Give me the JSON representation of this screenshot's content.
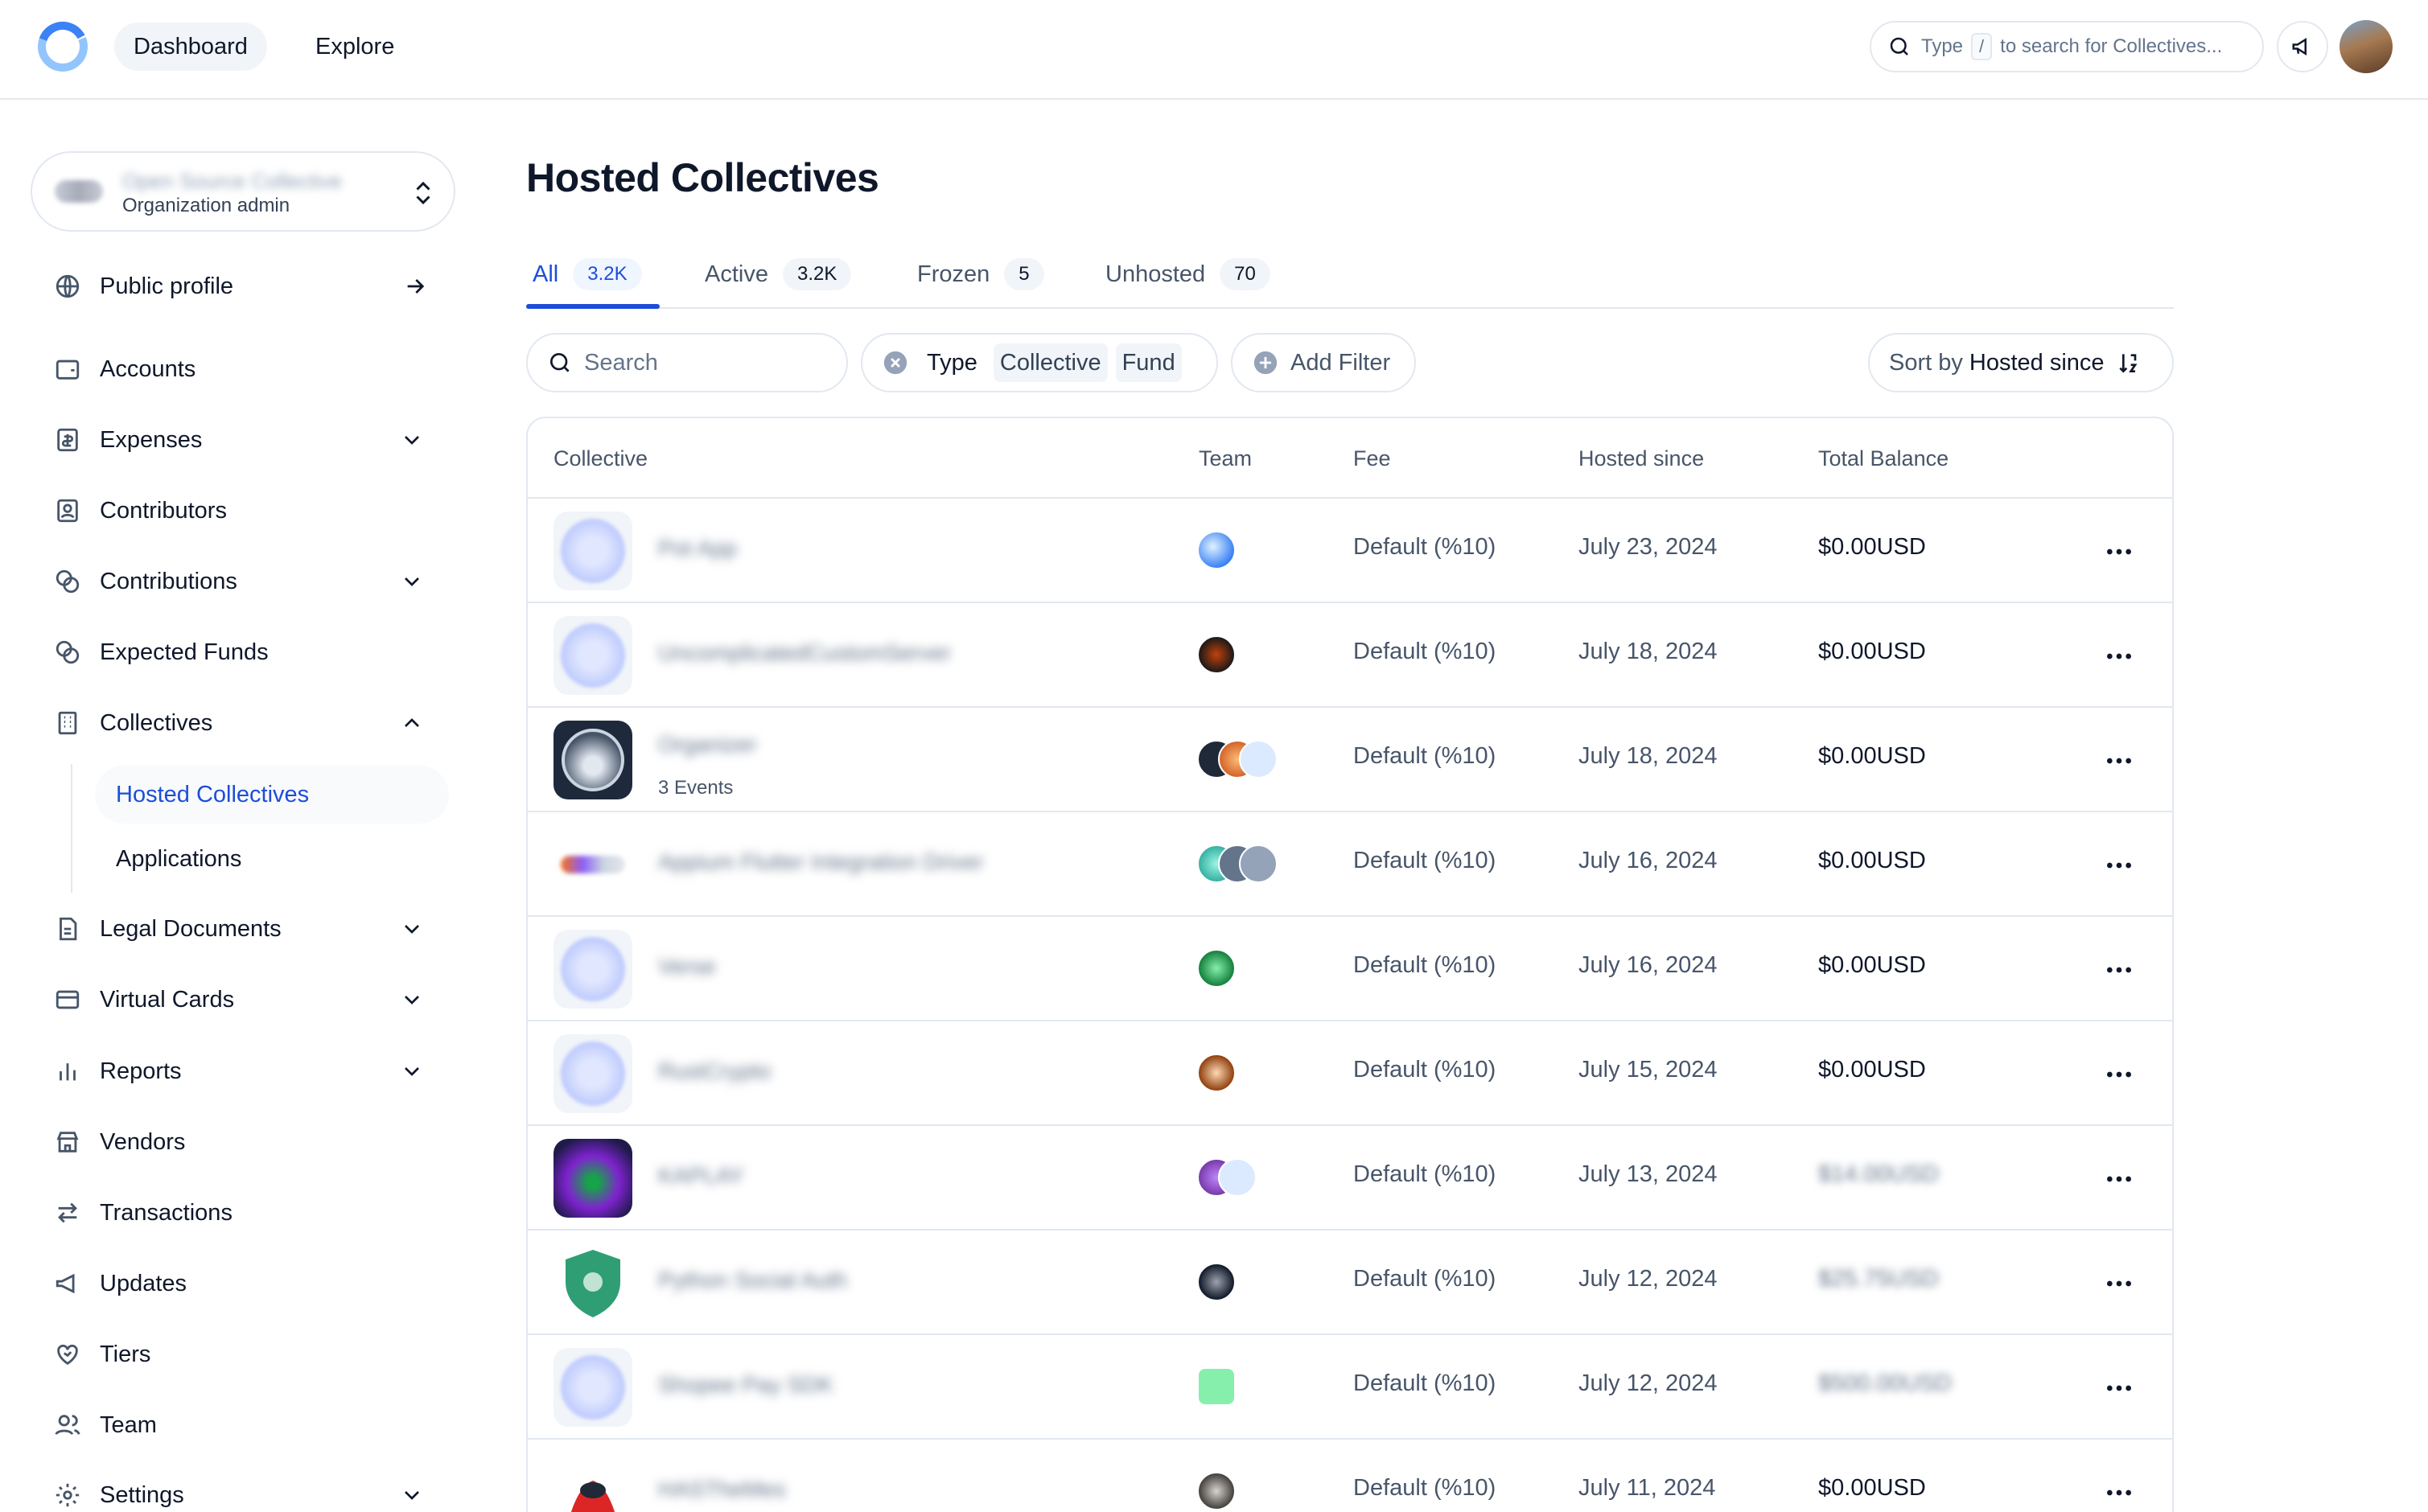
{
  "topbar": {
    "nav": [
      {
        "label": "Dashboard"
      },
      {
        "label": "Explore"
      }
    ],
    "search": {
      "prefix": "Type",
      "key": "/",
      "suffix": "to search for Collectives..."
    }
  },
  "account": {
    "name": "Open Source Collective",
    "role": "Organization admin"
  },
  "sidebar": {
    "items": [
      {
        "label": "Public profile",
        "icon": "globe-icon"
      },
      {
        "label": "Accounts",
        "icon": "wallet-icon"
      },
      {
        "label": "Expenses",
        "icon": "receipt-icon"
      },
      {
        "label": "Contributors",
        "icon": "contact-icon"
      },
      {
        "label": "Contributions",
        "icon": "coins-icon"
      },
      {
        "label": "Expected Funds",
        "icon": "coins-icon"
      },
      {
        "label": "Collectives",
        "icon": "building-icon"
      },
      {
        "label": "Legal Documents",
        "icon": "document-icon"
      },
      {
        "label": "Virtual Cards",
        "icon": "card-icon"
      },
      {
        "label": "Reports",
        "icon": "bar-chart-icon"
      },
      {
        "label": "Vendors",
        "icon": "store-icon"
      },
      {
        "label": "Transactions",
        "icon": "arrows-icon"
      },
      {
        "label": "Updates",
        "icon": "megaphone-icon"
      },
      {
        "label": "Tiers",
        "icon": "heart-handshake-icon"
      },
      {
        "label": "Team",
        "icon": "users-icon"
      },
      {
        "label": "Settings",
        "icon": "gear-icon"
      }
    ],
    "sub_items": [
      {
        "label": "Hosted Collectives"
      },
      {
        "label": "Applications"
      }
    ]
  },
  "main": {
    "title": "Hosted Collectives",
    "tabs": [
      {
        "label": "All",
        "count": "3.2K"
      },
      {
        "label": "Active",
        "count": "3.2K"
      },
      {
        "label": "Frozen",
        "count": "5"
      },
      {
        "label": "Unhosted",
        "count": "70"
      }
    ],
    "filters": {
      "search_placeholder": "Search",
      "type_label": "Type",
      "type_values": [
        "Collective",
        "Fund"
      ],
      "add_filter": "Add Filter",
      "sort_prefix": "Sort by",
      "sort_value": "Hosted since"
    },
    "table": {
      "columns": [
        "Collective",
        "Team",
        "Fee",
        "Hosted since",
        "Total Balance"
      ],
      "rows": [
        {
          "name": "Pot App",
          "events": "",
          "fee": "Default (%10)",
          "date": "July 23, 2024",
          "balance": "$0.00USD",
          "avatar_color": "#c7d2fe",
          "team_colors": [
            "#93c5fd"
          ]
        },
        {
          "name": "UncomplicatedCustomServer",
          "events": "",
          "fee": "Default (%10)",
          "date": "July 18, 2024",
          "balance": "$0.00USD",
          "avatar_color": "#c7d2fe",
          "team_colors": [
            "#7c2d12"
          ]
        },
        {
          "name": "Organizer",
          "events": "3 Events",
          "fee": "Default (%10)",
          "date": "July 18, 2024",
          "balance": "$0.00USD",
          "avatar_color": "#334155",
          "team_colors": [
            "#1f2937",
            "#ea8a4a",
            "#dbeafe"
          ]
        },
        {
          "name": "Appium Flutter Integration Driver",
          "events": "",
          "fee": "Default (%10)",
          "date": "July 16, 2024",
          "balance": "$0.00USD",
          "avatar_color": "#e5e7eb",
          "team_colors": [
            "#0ea5a4",
            "#64748b",
            "#94a3b8"
          ]
        },
        {
          "name": "Verse",
          "events": "",
          "fee": "Default (%10)",
          "date": "July 16, 2024",
          "balance": "$0.00USD",
          "avatar_color": "#c7d2fe",
          "team_colors": [
            "#16a34a"
          ]
        },
        {
          "name": "RustCrypto",
          "events": "",
          "fee": "Default (%10)",
          "date": "July 15, 2024",
          "balance": "$0.00USD",
          "avatar_color": "#c7d2fe",
          "team_colors": [
            "#a16207"
          ]
        },
        {
          "name": "KAPLAY",
          "events": "",
          "fee": "Default (%10)",
          "date": "July 13, 2024",
          "balance": "$14.00USD",
          "avatar_color": "#4c1d95",
          "team_colors": [
            "#7e22ce",
            "#dbeafe"
          ]
        },
        {
          "name": "Python Social Auth",
          "events": "",
          "fee": "Default (%10)",
          "date": "July 12, 2024",
          "balance": "$25.75USD",
          "avatar_color": "#ffffff",
          "team_colors": [
            "#374151"
          ]
        },
        {
          "name": "Shopee Pay SDK",
          "events": "",
          "fee": "Default (%10)",
          "date": "July 12, 2024",
          "balance": "$500.00USD",
          "avatar_color": "#c7d2fe",
          "team_colors": [
            "#4ade80"
          ]
        },
        {
          "name": "HASTheMes",
          "events": "",
          "fee": "Default (%10)",
          "date": "July 11, 2024",
          "balance": "$0.00USD",
          "avatar_color": "#ffffff",
          "team_colors": [
            "#57534e"
          ]
        }
      ]
    }
  },
  "colors": {
    "accent": "#1d4ed8",
    "border": "#e2e8f0",
    "muted_text": "#475569"
  }
}
